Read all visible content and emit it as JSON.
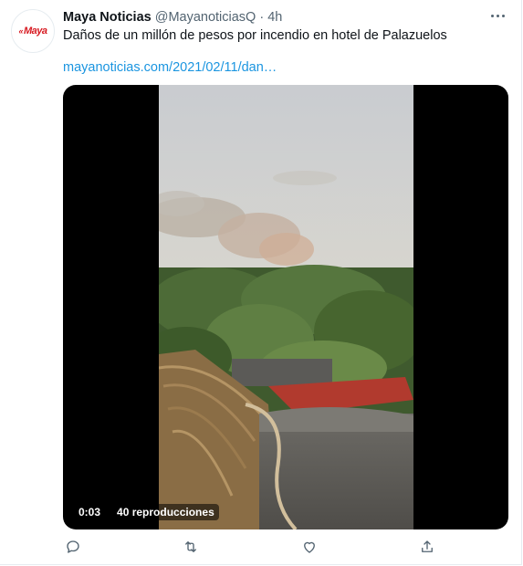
{
  "tweet": {
    "author_name": "Maya Noticias",
    "handle": "@MayanoticiasQ",
    "separator": "·",
    "time": "4h",
    "text": "Daños de un millón de pesos por incendio en hotel de Palazuelos",
    "link": "mayanoticias.com/2021/02/11/dan…",
    "avatar_logo": {
      "mark": "«",
      "word": "Maya",
      "tag": "•"
    }
  },
  "video": {
    "elapsed": "0:03",
    "views": "40 reproducciones"
  },
  "actions": {
    "reply": "reply-icon",
    "retweet": "retweet-icon",
    "like": "heart-icon",
    "share": "share-icon"
  },
  "colors": {
    "link": "#1b95e0",
    "secondary_text": "#536471",
    "brand_red": "#d71920"
  }
}
